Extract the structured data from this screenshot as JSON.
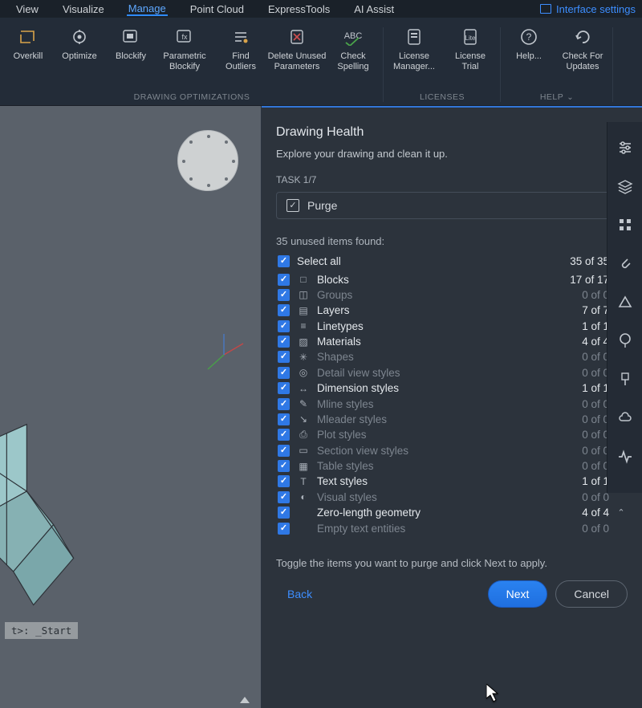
{
  "menubar": {
    "items": [
      "View",
      "Visualize",
      "Manage",
      "Point Cloud",
      "ExpressTools",
      "AI Assist"
    ],
    "active": "Manage",
    "interface_settings": "Interface settings"
  },
  "ribbon": {
    "groups": [
      {
        "label": "DRAWING OPTIMIZATIONS",
        "items": [
          {
            "label": "Overkill",
            "icon": "overkill-icon"
          },
          {
            "label": "Optimize",
            "icon": "optimize-icon"
          },
          {
            "label": "Blockify",
            "icon": "blockify-icon"
          },
          {
            "label": "Parametric\nBlockify",
            "icon": "parametric-blockify-icon"
          },
          {
            "label": "Find\nOutliers",
            "icon": "find-outliers-icon"
          },
          {
            "label": "Delete Unused\nParameters",
            "icon": "delete-unused-icon"
          },
          {
            "label": "Check\nSpelling",
            "icon": "check-spelling-icon"
          }
        ]
      },
      {
        "label": "LICENSES",
        "items": [
          {
            "label": "License\nManager...",
            "icon": "license-manager-icon"
          },
          {
            "label": "License\nTrial",
            "icon": "license-trial-icon"
          }
        ]
      },
      {
        "label": "HELP",
        "items": [
          {
            "label": "Help...",
            "icon": "help-icon"
          },
          {
            "label": "Check For\nUpdates",
            "icon": "check-updates-icon"
          }
        ]
      }
    ]
  },
  "viewport": {
    "command_text": "t>: _Start"
  },
  "panel": {
    "title": "Drawing Health",
    "subtitle": "Explore your drawing and clean it up.",
    "task_label": "TASK 1/7",
    "current_task": "Purge",
    "found_label": "35 unused items found:",
    "select_all": {
      "label": "Select all",
      "count": "35 of 35"
    },
    "items": [
      {
        "label": "Blocks",
        "count": "17 of 17",
        "dim": false,
        "icon": "□"
      },
      {
        "label": "Groups",
        "count": "0 of 0",
        "dim": true,
        "icon": "◫"
      },
      {
        "label": "Layers",
        "count": "7 of 7",
        "dim": false,
        "icon": "▤"
      },
      {
        "label": "Linetypes",
        "count": "1 of 1",
        "dim": false,
        "icon": "≡"
      },
      {
        "label": "Materials",
        "count": "4 of 4",
        "dim": false,
        "icon": "▨"
      },
      {
        "label": "Shapes",
        "count": "0 of 0",
        "dim": true,
        "icon": "✳"
      },
      {
        "label": "Detail view styles",
        "count": "0 of 0",
        "dim": true,
        "icon": "◎"
      },
      {
        "label": "Dimension styles",
        "count": "1 of 1",
        "dim": false,
        "icon": "↔"
      },
      {
        "label": "Mline styles",
        "count": "0 of 0",
        "dim": true,
        "icon": "✎"
      },
      {
        "label": "Mleader styles",
        "count": "0 of 0",
        "dim": true,
        "icon": "↘"
      },
      {
        "label": "Plot styles",
        "count": "0 of 0",
        "dim": true,
        "icon": "⎙"
      },
      {
        "label": "Section view styles",
        "count": "0 of 0",
        "dim": true,
        "icon": "▭"
      },
      {
        "label": "Table styles",
        "count": "0 of 0",
        "dim": true,
        "icon": "▦"
      },
      {
        "label": "Text styles",
        "count": "1 of 1",
        "dim": false,
        "icon": "T"
      },
      {
        "label": "Visual styles",
        "count": "0 of 0",
        "dim": true,
        "icon": "◐"
      },
      {
        "label": "Zero-length geometry",
        "count": "4 of 4",
        "dim": false,
        "icon": ""
      },
      {
        "label": "Empty text entities",
        "count": "0 of 0",
        "dim": true,
        "icon": ""
      }
    ],
    "footer_hint": "Toggle the items you want to purge and click Next to apply.",
    "back": "Back",
    "next": "Next",
    "cancel": "Cancel"
  },
  "sidetools": [
    "settings-sliders-icon",
    "layers-icon",
    "grid-icon",
    "attach-icon",
    "triangle-icon",
    "balloon-icon",
    "brush-icon",
    "cloud-icon",
    "activity-icon"
  ]
}
